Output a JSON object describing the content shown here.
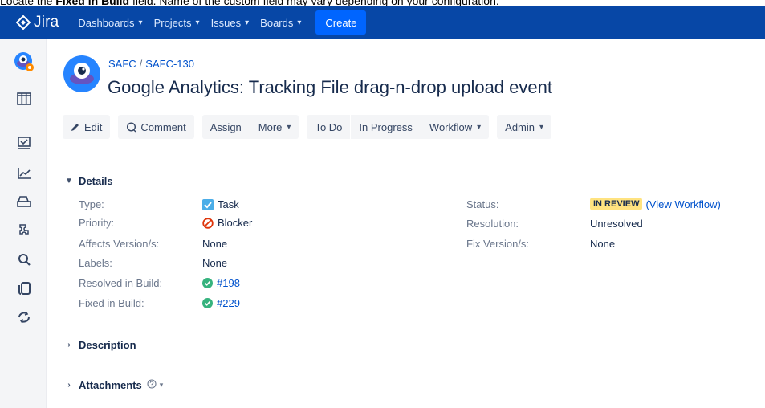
{
  "caption": {
    "pre": "Locate the ",
    "bold": "Fixed in Build",
    "post": " field. Name of the custom field may vary depending on your configuration."
  },
  "topnav": {
    "logo_text": "Jira",
    "items": [
      {
        "label": "Dashboards"
      },
      {
        "label": "Projects"
      },
      {
        "label": "Issues"
      },
      {
        "label": "Boards"
      }
    ],
    "create_label": "Create",
    "colors": {
      "background": "#0747a6",
      "create": "#0065ff"
    }
  },
  "sidebar": {
    "icons": [
      "project-avatar",
      "board-icon",
      "backlog-icon",
      "reports-icon",
      "releases-icon",
      "components-icon",
      "search-icon",
      "pages-icon",
      "sync-icon"
    ]
  },
  "issue": {
    "project_key": "SAFC",
    "issue_key": "SAFC-130",
    "title": "Google Analytics: Tracking File drag-n-drop upload event"
  },
  "toolbar": {
    "edit": "Edit",
    "comment": "Comment",
    "assign": "Assign",
    "more": "More",
    "todo": "To Do",
    "in_progress": "In Progress",
    "workflow": "Workflow",
    "admin": "Admin"
  },
  "details": {
    "heading": "Details",
    "left": [
      {
        "label": "Type:",
        "value": "Task"
      },
      {
        "label": "Priority:",
        "value": "Blocker"
      },
      {
        "label": "Affects Version/s:",
        "value": "None"
      },
      {
        "label": "Labels:",
        "value": "None"
      },
      {
        "label": "Resolved in Build:",
        "value": "#198"
      },
      {
        "label": "Fixed in Build:",
        "value": "#229"
      }
    ],
    "right": [
      {
        "label": "Status:",
        "value": "IN REVIEW",
        "link": "(View Workflow)"
      },
      {
        "label": "Resolution:",
        "value": "Unresolved"
      },
      {
        "label": "Fix Version/s:",
        "value": "None"
      }
    ]
  },
  "sections": {
    "description": "Description",
    "attachments": "Attachments"
  }
}
